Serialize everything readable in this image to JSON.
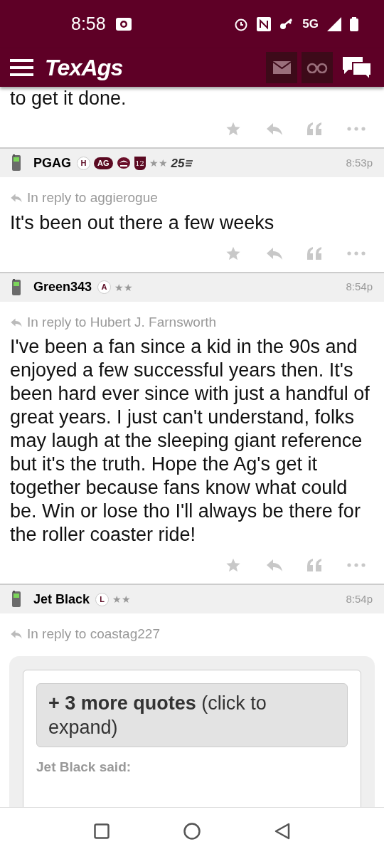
{
  "status_bar": {
    "time": "8:58",
    "network": "5G"
  },
  "header": {
    "logo": "TexAgs"
  },
  "partial_post": {
    "body": "to get it done."
  },
  "posts": [
    {
      "username": "PGAG",
      "time": "8:53p",
      "badges": [
        {
          "kind": "circle",
          "text": "H"
        },
        {
          "kind": "pill",
          "text": "AG"
        },
        {
          "kind": "emblem"
        },
        {
          "kind": "shield",
          "text": "12"
        },
        {
          "kind": "stars",
          "text": "★★"
        },
        {
          "kind": "rank",
          "text": "25"
        }
      ],
      "reply_to": "In reply to aggierogue",
      "body": "It's been out there a few weeks"
    },
    {
      "username": "Green343",
      "time": "8:54p",
      "badges": [
        {
          "kind": "circle",
          "text": "A"
        },
        {
          "kind": "stars",
          "text": "★★"
        }
      ],
      "reply_to": "In reply to Hubert J. Farnsworth",
      "body": "I've been a fan since a kid in the 90s and enjoyed a few successful years then. It's been hard ever since with just a handful of great years. I just can't understand, folks may laugh at the sleeping giant reference but it's the truth. Hope the Ag's get it together because fans know what could be. Win or lose tho I'll always be there for the roller coaster ride!"
    },
    {
      "username": "Jet Black",
      "time": "8:54p",
      "badges": [
        {
          "kind": "circle",
          "text": "L"
        },
        {
          "kind": "stars",
          "text": "★★"
        }
      ],
      "reply_to": "In reply to coastag227",
      "quote": {
        "more_quotes": "**+ 3 more quotes** (click to expand)",
        "author": "Jet Black said:"
      }
    }
  ]
}
